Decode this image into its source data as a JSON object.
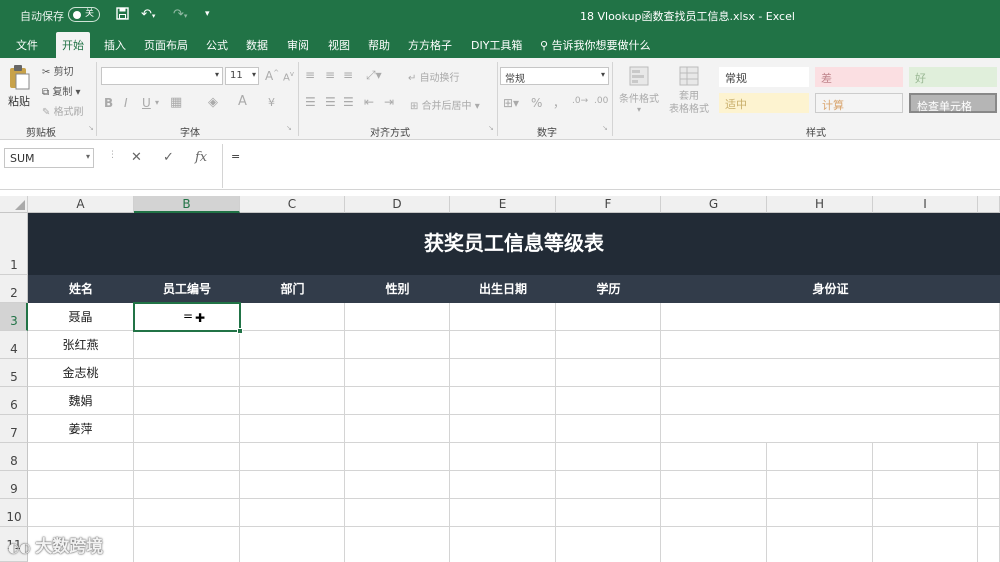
{
  "titlebar": {
    "autosave": "自动保存",
    "toggle": "关",
    "doc_title": "18 Vlookup函数查找员工信息.xlsx  -  Excel"
  },
  "menu": [
    "文件",
    "开始",
    "插入",
    "页面布局",
    "公式",
    "数据",
    "审阅",
    "视图",
    "帮助",
    "方方格子",
    "DIY工具箱",
    "告诉我你想要做什么"
  ],
  "ribbon": {
    "clipboard": {
      "paste": "粘贴",
      "cut": "剪切",
      "copy": "复制",
      "painter": "格式刷",
      "label": "剪贴板"
    },
    "font": {
      "size": "11",
      "grow": "A",
      "shrink": "A",
      "label": "字体"
    },
    "align": {
      "wrap": "自动换行",
      "merge": "合并后居中",
      "label": "对齐方式"
    },
    "number": {
      "format": "常规",
      "percent": "%",
      "comma": "，",
      "label": "数字"
    },
    "cond": {
      "cond": "条件格式",
      "table": "套用\n表格格式"
    },
    "styles": {
      "normal": "常规",
      "bad": "差",
      "good": "好",
      "neutral": "适中",
      "calc": "计算",
      "check": "检查单元格",
      "label": "样式"
    }
  },
  "formula": {
    "namebox": "SUM",
    "cancel": "✕",
    "enter": "✓",
    "fx": "fx",
    "content": "="
  },
  "columns": [
    "A",
    "B",
    "C",
    "D",
    "E",
    "F",
    "G",
    "H",
    "I"
  ],
  "rows": [
    "1",
    "2",
    "3",
    "4",
    "5",
    "6",
    "7",
    "8",
    "9",
    "10",
    "11"
  ],
  "sheet": {
    "title": "获奖员工信息等级表",
    "headers": [
      "姓名",
      "员工编号",
      "部门",
      "性别",
      "出生日期",
      "学历",
      "身份证"
    ],
    "names": [
      "聂晶",
      "张红燕",
      "金志桃",
      "魏娟",
      "姜萍"
    ],
    "active_cell_text": "="
  },
  "watermark": "大数跨境",
  "colors": {
    "excel_green": "#217346",
    "banner": "#222b36",
    "header_row": "#323c4a"
  }
}
